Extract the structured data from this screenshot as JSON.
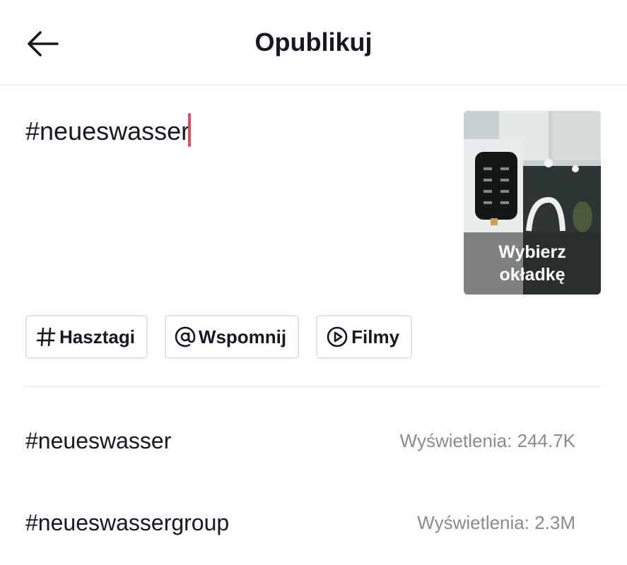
{
  "header": {
    "title": "Opublikuj",
    "back_icon": "arrow-left-icon"
  },
  "caption": {
    "text": "#neueswasser",
    "caret_color": "#e24a5e"
  },
  "cover": {
    "label_line1": "Wybierz",
    "label_line2": "okładkę"
  },
  "chips": [
    {
      "label": "Hasztagi",
      "icon": "hashtag-icon"
    },
    {
      "label": "Wspomnij",
      "icon": "at-icon"
    },
    {
      "label": "Filmy",
      "icon": "play-circle-icon"
    }
  ],
  "suggestions": [
    {
      "tag": "#neueswasser",
      "views": "Wyświetlenia: 244.7K"
    },
    {
      "tag": "#neueswassergroup",
      "views": "Wyświetlenia: 2.3M"
    }
  ],
  "colors": {
    "text": "#161823",
    "muted": "#8a8b91",
    "border": "#e3e3e4",
    "caret": "#e24a5e"
  }
}
